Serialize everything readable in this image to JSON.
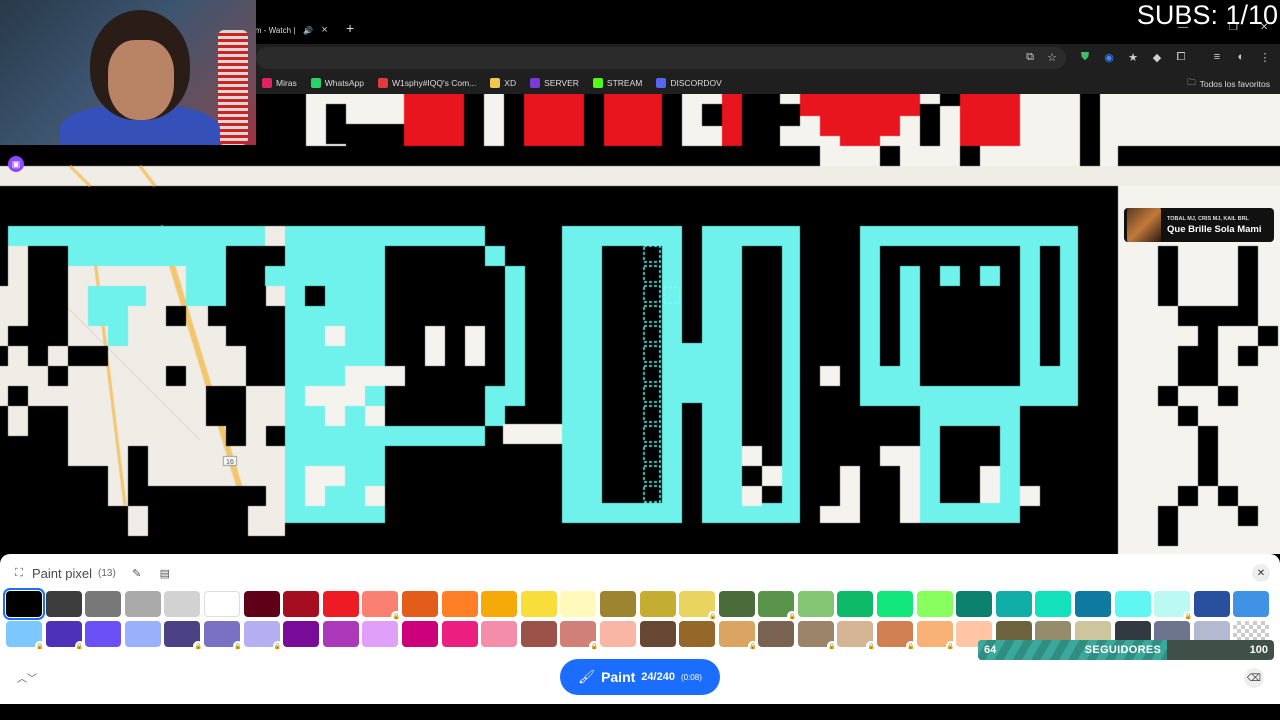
{
  "browser": {
    "tab_title": "eam - Watch |",
    "tab_close": "×",
    "new_tab": "+",
    "window_controls": [
      "—",
      "❐",
      "✕"
    ],
    "bookmarks": [
      {
        "label": "Miras",
        "icon": "x-icon",
        "color": "#e0245e"
      },
      {
        "label": "WhatsApp",
        "icon": "whatsapp-icon",
        "color": "#25d366"
      },
      {
        "label": "W1sphy#IQQ's Com...",
        "icon": "community-icon",
        "color": "#e03a3a"
      },
      {
        "label": "XD",
        "icon": "emoji-icon",
        "color": "#f2c94c"
      },
      {
        "label": "SERVER",
        "icon": "server-icon",
        "color": "#7a3ad8"
      },
      {
        "label": "STREAM",
        "icon": "kick-icon",
        "color": "#53fc18"
      },
      {
        "label": "DISCORDOV",
        "icon": "discord-icon",
        "color": "#5865f2"
      }
    ],
    "all_bookmarks": "Todos los favoritos"
  },
  "overlay": {
    "subs": "SUBS: 1/10"
  },
  "song": {
    "artist": "TOBAL MJ, CRIS MJ, KAIL BRL",
    "title": "Que Brille Sola Mami"
  },
  "canvas": {
    "road_label": "16",
    "colors": {
      "cyan": "#6ff2ec",
      "red": "#e8141e",
      "black": "#000000",
      "white": "#f5f3ee",
      "map": "#f0ece6"
    }
  },
  "panel": {
    "title": "Paint pixel",
    "count": "(13)",
    "palette": [
      {
        "color": "#000000",
        "locked": false,
        "selected": true
      },
      {
        "color": "#3c3c3c",
        "locked": false
      },
      {
        "color": "#787878",
        "locked": false
      },
      {
        "color": "#aaaaaa",
        "locked": false
      },
      {
        "color": "#d2d2d2",
        "locked": false
      },
      {
        "color": "#ffffff",
        "locked": false
      },
      {
        "color": "#600018",
        "locked": false
      },
      {
        "color": "#a50e1e",
        "locked": false
      },
      {
        "color": "#ed1c24",
        "locked": false
      },
      {
        "color": "#fa8072",
        "locked": true
      },
      {
        "color": "#e45c1a",
        "locked": false
      },
      {
        "color": "#ff7f27",
        "locked": false
      },
      {
        "color": "#f6aa09",
        "locked": false
      },
      {
        "color": "#f9dd3b",
        "locked": false
      },
      {
        "color": "#fffabc",
        "locked": false
      },
      {
        "color": "#9c8431",
        "locked": false
      },
      {
        "color": "#c5ad31",
        "locked": false
      },
      {
        "color": "#e8d45f",
        "locked": true
      },
      {
        "color": "#4a6b3a",
        "locked": false
      },
      {
        "color": "#5a944a",
        "locked": true
      },
      {
        "color": "#84c573",
        "locked": false
      },
      {
        "color": "#0eb968",
        "locked": false
      },
      {
        "color": "#13e67b",
        "locked": false
      },
      {
        "color": "#87ff5e",
        "locked": false
      },
      {
        "color": "#0c816e",
        "locked": false
      },
      {
        "color": "#10aea6",
        "locked": false
      },
      {
        "color": "#13e1be",
        "locked": false
      },
      {
        "color": "#0f799f",
        "locked": false
      },
      {
        "color": "#60f7f2",
        "locked": false
      },
      {
        "color": "#bbfaf2",
        "locked": true
      },
      {
        "color": "#28509e",
        "locked": false
      },
      {
        "color": "#4093e4",
        "locked": false
      },
      {
        "color": "#7dc7ff",
        "locked": true
      },
      {
        "color": "#4d31b8",
        "locked": true
      },
      {
        "color": "#6b50f6",
        "locked": false
      },
      {
        "color": "#99b1fb",
        "locked": false
      },
      {
        "color": "#4a4284",
        "locked": true
      },
      {
        "color": "#7a71c4",
        "locked": true
      },
      {
        "color": "#b5aef1",
        "locked": true
      },
      {
        "color": "#780c99",
        "locked": false
      },
      {
        "color": "#aa38b9",
        "locked": false
      },
      {
        "color": "#e09ff9",
        "locked": false
      },
      {
        "color": "#cb007a",
        "locked": false
      },
      {
        "color": "#ec1f80",
        "locked": false
      },
      {
        "color": "#f38da9",
        "locked": false
      },
      {
        "color": "#9b5249",
        "locked": false
      },
      {
        "color": "#d18078",
        "locked": true
      },
      {
        "color": "#fab6a4",
        "locked": false
      },
      {
        "color": "#684634",
        "locked": false
      },
      {
        "color": "#95682a",
        "locked": false
      },
      {
        "color": "#dba463",
        "locked": true
      },
      {
        "color": "#7b6352",
        "locked": false
      },
      {
        "color": "#9c846b",
        "locked": true
      },
      {
        "color": "#d6b594",
        "locked": true
      },
      {
        "color": "#d18051",
        "locked": true
      },
      {
        "color": "#f8b277",
        "locked": true
      },
      {
        "color": "#ffc5a5",
        "locked": true
      },
      {
        "color": "#6d643f",
        "locked": false
      },
      {
        "color": "#948c6b",
        "locked": false
      },
      {
        "color": "#cdc59e",
        "locked": true
      },
      {
        "color": "#333941",
        "locked": false
      },
      {
        "color": "#6d758d",
        "locked": false
      },
      {
        "color": "#b3b9d1",
        "locked": true
      },
      {
        "color": "transparent",
        "locked": false
      }
    ],
    "paint_label": "Paint",
    "paint_count": "24/240",
    "paint_time": "(0:08)"
  },
  "followers": {
    "current": "64",
    "label": "SEGUIDORES",
    "goal": "100",
    "progress": 0.64
  }
}
